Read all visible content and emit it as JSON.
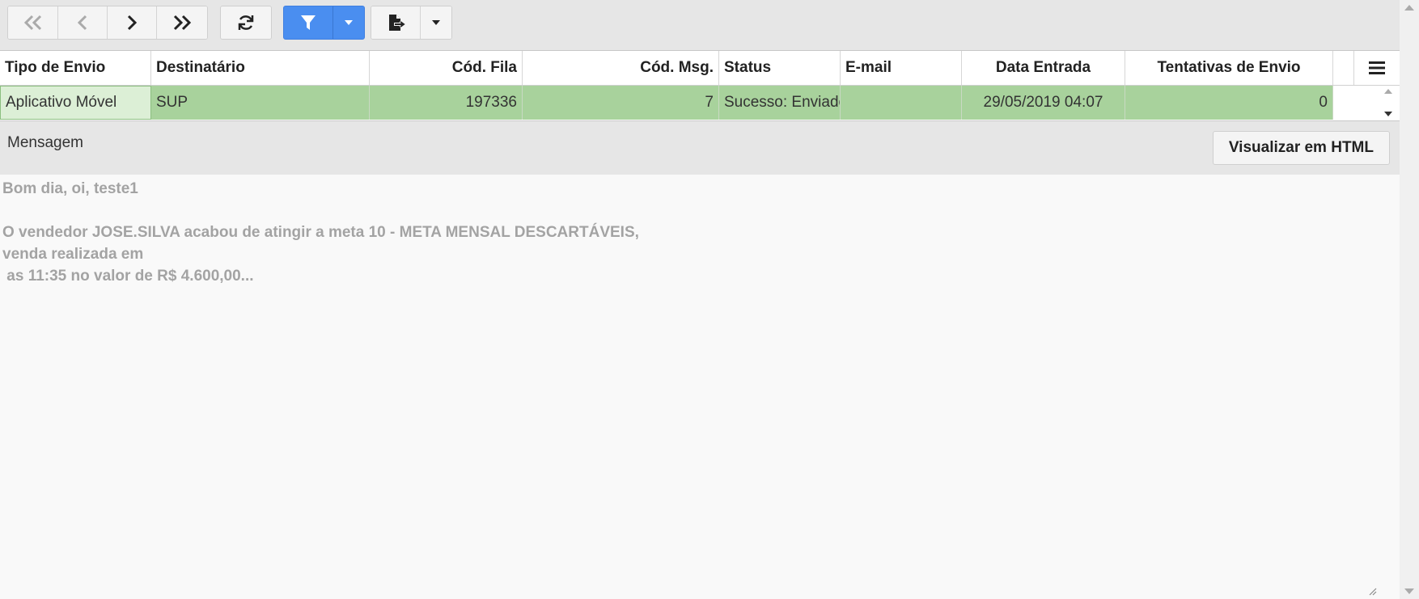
{
  "toolbar": {
    "nav": [
      {
        "name": "first-page-icon",
        "enabled": false
      },
      {
        "name": "previous-page-icon",
        "enabled": false
      },
      {
        "name": "next-page-icon",
        "enabled": true
      },
      {
        "name": "last-page-icon",
        "enabled": true
      }
    ],
    "refresh_icon": "refresh-icon",
    "filter_icon": "filter-icon",
    "export_icon": "export-icon",
    "accent_color": "#4a8ef0"
  },
  "grid": {
    "columns": [
      {
        "label": "Tipo de Envio"
      },
      {
        "label": "Destinatário"
      },
      {
        "label": "Cód. Fila"
      },
      {
        "label": "Cód. Msg."
      },
      {
        "label": "Status"
      },
      {
        "label": "E-mail"
      },
      {
        "label": "Data Entrada"
      },
      {
        "label": "Tentativas de Envio"
      }
    ],
    "rows": [
      {
        "tipo_envio": "Aplicativo Móvel",
        "destinatario": "SUP",
        "cod_fila": "197336",
        "cod_msg": "7",
        "status": "Sucesso: Enviado",
        "email": "",
        "data_entrada": "29/05/2019 04:07",
        "tentativas": "0"
      }
    ],
    "row_color": "#a8d29c"
  },
  "message": {
    "label": "Mensagem",
    "view_html_button": "Visualizar em HTML",
    "body": "Bom dia, oi, teste1\n\nO vendedor JOSE.SILVA acabou de atingir a meta 10 - META MENSAL DESCARTÁVEIS,\nvenda realizada em\n as 11:35 no valor de R$ 4.600,00..."
  }
}
